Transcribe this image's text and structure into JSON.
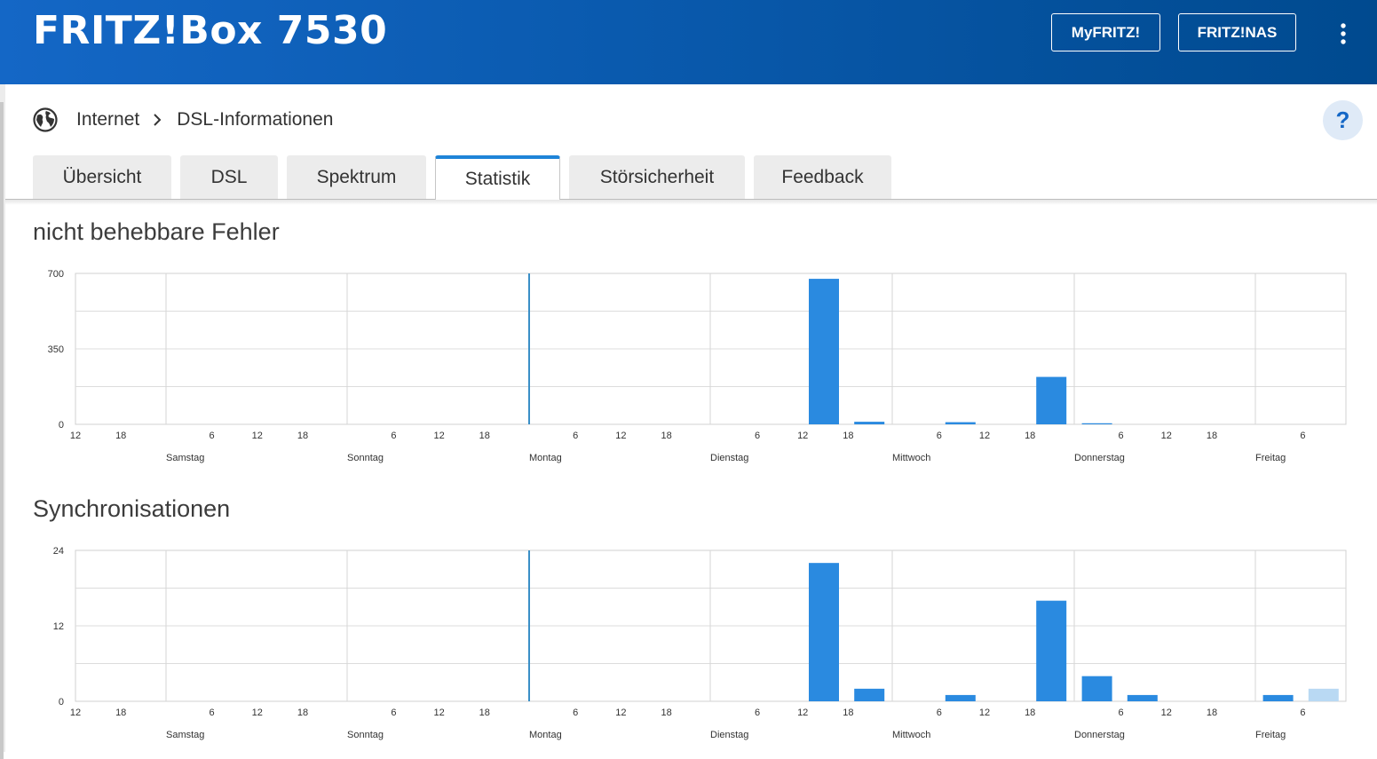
{
  "header": {
    "title": "FRITZ!Box 7530",
    "buttons": [
      "MyFRITZ!",
      "FRITZ!NAS"
    ],
    "menu_icon": "more-vertical-icon"
  },
  "breadcrumb": {
    "icon": "globe-icon",
    "items": [
      "Internet",
      "DSL-Informationen"
    ],
    "separator_icon": "chevron-right-icon"
  },
  "help": {
    "label": "?"
  },
  "tabs": [
    {
      "label": "Übersicht",
      "active": false
    },
    {
      "label": "DSL",
      "active": false
    },
    {
      "label": "Spektrum",
      "active": false
    },
    {
      "label": "Statistik",
      "active": true
    },
    {
      "label": "Störsicherheit",
      "active": false
    },
    {
      "label": "Feedback",
      "active": false
    }
  ],
  "colors": {
    "accent": "#1e84d8",
    "bar": "#2a8ae0",
    "bar_current": "#b9d9f3",
    "header_start": "#1467c6",
    "header_end": "#004a8f",
    "now_line": "#3a8fc7"
  },
  "sections": [
    {
      "title": "nicht behebbare Fehler",
      "chart_data": {
        "type": "bar",
        "ylim": [
          0,
          700
        ],
        "yticks": [
          0,
          350,
          700
        ],
        "xticks": [
          "12",
          "18",
          "",
          "6",
          "12",
          "18",
          "",
          "6",
          "12",
          "18",
          "",
          "6",
          "12",
          "18",
          "",
          "6",
          "12",
          "18",
          "",
          "6",
          "12",
          "18",
          "",
          "6",
          "12",
          "18",
          "",
          "6"
        ],
        "days": [
          "Samstag",
          "Sonntag",
          "Montag",
          "Dienstag",
          "Mittwoch",
          "Donnerstag",
          "Freitag"
        ],
        "now_marker": "Montag 00:00",
        "bars": [
          {
            "day": "Dienstag",
            "hour": 12,
            "value": 675
          },
          {
            "day": "Dienstag",
            "hour": 18,
            "value": 12
          },
          {
            "day": "Mittwoch",
            "hour": 6,
            "value": 10
          },
          {
            "day": "Mittwoch",
            "hour": 18,
            "value": 220
          },
          {
            "day": "Donnerstag",
            "hour": 0,
            "value": 5
          }
        ]
      }
    },
    {
      "title": "Synchronisationen",
      "chart_data": {
        "type": "bar",
        "ylim": [
          0,
          24
        ],
        "yticks": [
          0,
          12,
          24
        ],
        "xticks": [
          "12",
          "18",
          "",
          "6",
          "12",
          "18",
          "",
          "6",
          "12",
          "18",
          "",
          "6",
          "12",
          "18",
          "",
          "6",
          "12",
          "18",
          "",
          "6",
          "12",
          "18",
          "",
          "6",
          "12",
          "18",
          "",
          "6"
        ],
        "days": [
          "Samstag",
          "Sonntag",
          "Montag",
          "Dienstag",
          "Mittwoch",
          "Donnerstag",
          "Freitag"
        ],
        "now_marker": "Montag 00:00",
        "bars": [
          {
            "day": "Dienstag",
            "hour": 12,
            "value": 22
          },
          {
            "day": "Dienstag",
            "hour": 18,
            "value": 2
          },
          {
            "day": "Mittwoch",
            "hour": 6,
            "value": 1
          },
          {
            "day": "Mittwoch",
            "hour": 18,
            "value": 16
          },
          {
            "day": "Donnerstag",
            "hour": 0,
            "value": 4
          },
          {
            "day": "Donnerstag",
            "hour": 6,
            "value": 1
          },
          {
            "day": "Freitag",
            "hour": 0,
            "value": 1
          },
          {
            "day": "Freitag",
            "hour": 6,
            "value": 2,
            "current": true
          }
        ]
      }
    }
  ]
}
